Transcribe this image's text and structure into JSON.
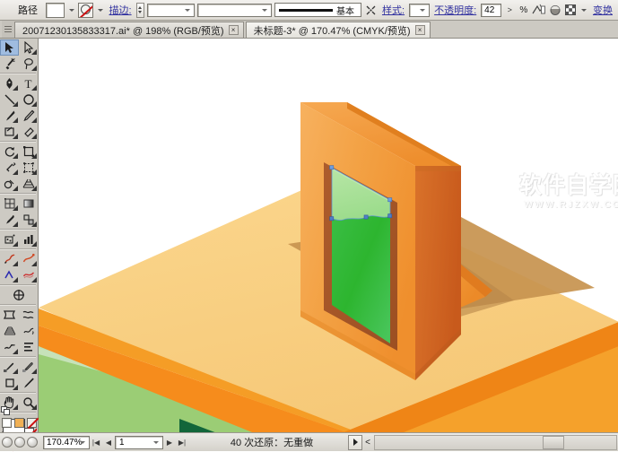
{
  "app": {
    "name": "Adobe Illustrator",
    "theme_bg": "#d6d3ce"
  },
  "control_bar": {
    "object_label": "路径",
    "fill_swatch_value": "白色",
    "stroke_swatch_value": "无",
    "stroke_label": "描边:",
    "stroke_weight_value": "",
    "stroke_profile_value": "",
    "brush_value": "",
    "style_stroke_label": "基本",
    "style_label": "样式:",
    "style_value": "",
    "opacity_label": "不透明度:",
    "opacity_value": "42",
    "opacity_unit": "%",
    "transform_label": "变换",
    "icons": {
      "fill": "fill-swatch-icon",
      "stroke": "stroke-none-icon",
      "stroke_spinner": "stroke-weight-spinner-icon",
      "brush_caret": "chevron-down-icon",
      "style_swatch": "style-swatch-icon",
      "opacity_caret": "opacity-slider-icon",
      "mask": "opacity-mask-icon",
      "align": "align-icon",
      "shape": "shape-mode-icon",
      "transparency": "transparency-grid-icon"
    }
  },
  "tabs": [
    {
      "title": "20071230135833317.ai*  @  198%  (RGB/预览)",
      "active": false,
      "close_label": "×"
    },
    {
      "title": "未标题-3*  @  170.47%  (CMYK/预览)",
      "active": true,
      "close_label": "×"
    }
  ],
  "toolbox": {
    "active_tool": "selection-tool",
    "tools": [
      {
        "name": "selection-tool",
        "label": "选择工具"
      },
      {
        "name": "direct-selection-tool",
        "label": "直接选择工具"
      },
      {
        "name": "magic-wand-tool",
        "label": "魔棒工具"
      },
      {
        "name": "lasso-tool",
        "label": "套索工具"
      },
      {
        "name": "pen-tool",
        "label": "钢笔工具"
      },
      {
        "name": "type-tool",
        "label": "文字工具"
      },
      {
        "name": "line-segment-tool",
        "label": "直线段工具"
      },
      {
        "name": "ellipse-tool",
        "label": "椭圆工具"
      },
      {
        "name": "paintbrush-tool",
        "label": "画笔工具"
      },
      {
        "name": "pencil-tool",
        "label": "铅笔工具"
      },
      {
        "name": "blob-brush-tool",
        "label": "斑点画笔工具"
      },
      {
        "name": "eraser-tool",
        "label": "橡皮擦工具"
      },
      {
        "name": "rotate-tool",
        "label": "旋转工具"
      },
      {
        "name": "scale-tool",
        "label": "比例缩放工具"
      },
      {
        "name": "width-tool",
        "label": "宽度工具"
      },
      {
        "name": "free-transform-tool",
        "label": "自由变换工具"
      },
      {
        "name": "shape-builder-tool",
        "label": "形状生成器工具"
      },
      {
        "name": "perspective-grid-tool",
        "label": "透视网格工具"
      },
      {
        "name": "mesh-tool",
        "label": "网格工具"
      },
      {
        "name": "gradient-tool",
        "label": "渐变工具"
      },
      {
        "name": "eyedropper-tool",
        "label": "吸管工具"
      },
      {
        "name": "blend-tool",
        "label": "混合工具"
      },
      {
        "name": "symbol-sprayer-tool",
        "label": "符号喷枪工具"
      },
      {
        "name": "column-graph-tool",
        "label": "柱形图工具"
      },
      {
        "name": "artboard-tool",
        "label": "画板工具"
      },
      {
        "name": "slice-tool",
        "label": "切片工具"
      },
      {
        "name": "warp-tool",
        "label": "变形工具"
      },
      {
        "name": "free-distort-tool",
        "label": "自由扭曲工具"
      },
      {
        "name": "gradient-mesh-tool",
        "label": "渐变网格工具"
      },
      {
        "name": "live-paint-bucket-tool",
        "label": "实时上色工具"
      },
      {
        "name": "pencil-smooth-tool",
        "label": "平滑工具"
      },
      {
        "name": "align-tool",
        "label": "对齐工具"
      },
      {
        "name": "eyedropper-measure-tool",
        "label": "度量工具"
      },
      {
        "name": "scissors-tool",
        "label": "剪刀工具"
      },
      {
        "name": "crop-area-tool",
        "label": "裁剪区域工具"
      },
      {
        "name": "knife-tool",
        "label": "美工刀工具"
      },
      {
        "name": "hand-tool",
        "label": "抓手工具"
      },
      {
        "name": "zoom-tool",
        "label": "缩放工具"
      }
    ],
    "fill_label": "填色",
    "stroke_label": "描边",
    "color_modes": [
      {
        "name": "color-mode-color",
        "label": "颜色"
      },
      {
        "name": "color-mode-gradient",
        "label": "渐变"
      },
      {
        "name": "color-mode-none",
        "label": "无"
      }
    ],
    "screen_modes": [
      {
        "name": "screen-mode-normal",
        "label": "正常屏幕模式"
      },
      {
        "name": "screen-mode-full-menu",
        "label": "带有菜单栏的全屏模式"
      },
      {
        "name": "screen-mode-full",
        "label": "全屏模式"
      }
    ]
  },
  "canvas": {
    "watermark_main": "软件自学网",
    "watermark_sub": "WWW.RJZXW.COM",
    "artwork": {
      "description": "等角立体画框放在平台上",
      "frame_front_color": "#f0a04b",
      "frame_side_color": "#d4641e",
      "frame_inner_color": "#a8562a",
      "picture_top_color": "#a6dc95",
      "picture_bottom_color": "#2bb02b",
      "platform_top_color": "#f7cf82",
      "platform_front_color": "#f6a32a",
      "platform_side_color": "#f0881a",
      "grass_color": "#9bcd75",
      "shadow_color": "#c79350"
    }
  },
  "status_bar": {
    "zoom_value": "170.47%",
    "page_value": "1",
    "undo_info": "40 次还原：无重做",
    "nav_first": "|◀",
    "nav_prev": "◀",
    "nav_next": "▶",
    "nav_last": "▶|",
    "caret_label": "<"
  }
}
